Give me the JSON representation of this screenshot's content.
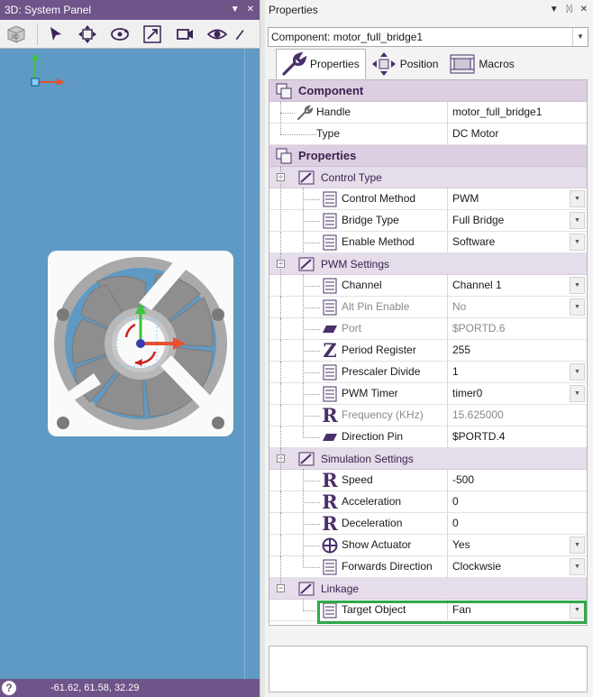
{
  "left_panel": {
    "title": "3D: System Panel",
    "toolbar": [
      "3d-view-icon",
      "pointer-icon",
      "move-icon",
      "orbit-icon",
      "zoom-fit-icon",
      "record-icon",
      "eye-icon",
      "draw-icon"
    ],
    "status_coords": "-61.62, 61.58, 32.29",
    "help_glyph": "?"
  },
  "right_panel": {
    "title": "Properties",
    "component_select": "Component: motor_full_bridge1",
    "tabs": [
      {
        "label": "Properties",
        "icon": "wrench-icon"
      },
      {
        "label": "Position",
        "icon": "move-arrows-icon"
      },
      {
        "label": "Macros",
        "icon": "macro-icon"
      }
    ],
    "component_header": "Component",
    "handle": {
      "name": "Handle",
      "value": "motor_full_bridge1"
    },
    "type": {
      "name": "Type",
      "value": "DC Motor"
    },
    "properties_header": "Properties",
    "control_type": {
      "label": "Control Type",
      "rows": [
        {
          "name": "Control Method",
          "value": "PWM"
        },
        {
          "name": "Bridge Type",
          "value": "Full Bridge"
        },
        {
          "name": "Enable Method",
          "value": "Software"
        }
      ]
    },
    "pwm_settings": {
      "label": "PWM Settings",
      "rows": [
        {
          "name": "Channel",
          "value": "Channel 1"
        },
        {
          "name": "Alt Pin Enable",
          "value": "No"
        },
        {
          "name": "Port",
          "value": "$PORTD.6"
        },
        {
          "name": "Period Register",
          "value": "255"
        },
        {
          "name": "Prescaler Divide",
          "value": "1"
        },
        {
          "name": "PWM Timer",
          "value": "timer0"
        },
        {
          "name": "Frequency (KHz)",
          "value": "15.625000"
        },
        {
          "name": "Direction Pin",
          "value": "$PORTD.4"
        }
      ]
    },
    "simulation_settings": {
      "label": "Simulation Settings",
      "rows": [
        {
          "name": "Speed",
          "value": "-500"
        },
        {
          "name": "Acceleration",
          "value": "0"
        },
        {
          "name": "Deceleration",
          "value": "0"
        },
        {
          "name": "Show Actuator",
          "value": "Yes"
        },
        {
          "name": "Forwards Direction",
          "value": "Clockwsie"
        }
      ]
    },
    "linkage": {
      "label": "Linkage",
      "rows": [
        {
          "name": "Target Object",
          "value": "Fan"
        }
      ]
    },
    "colors": {
      "category_bg": "#dccfe1",
      "highlight": "#2fa84a",
      "title_bar": "#6e5488"
    }
  }
}
